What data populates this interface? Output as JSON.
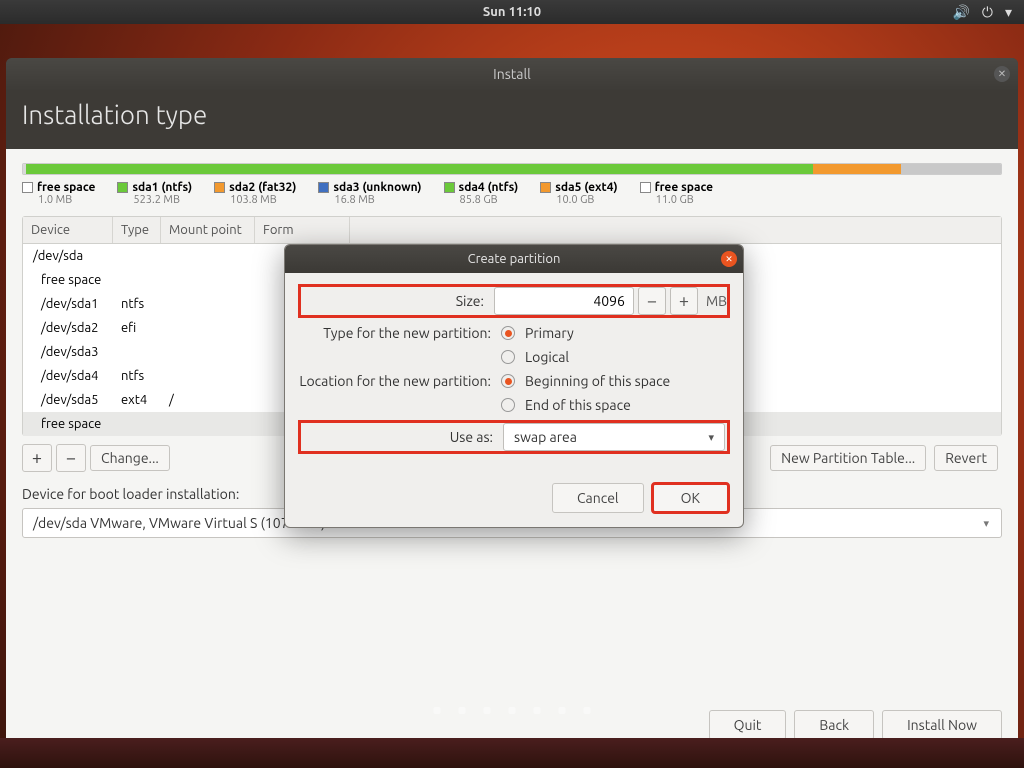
{
  "menubar": {
    "clock": "Sun 11:10"
  },
  "install": {
    "windowtitle": "Install",
    "heading": "Installation type",
    "legend": [
      {
        "name": "free space",
        "size": "1.0 MB",
        "swatch": "gray"
      },
      {
        "name": "sda1 (ntfs)",
        "size": "523.2 MB",
        "swatch": "green"
      },
      {
        "name": "sda2 (fat32)",
        "size": "103.8 MB",
        "swatch": "orange"
      },
      {
        "name": "sda3 (unknown)",
        "size": "16.8 MB",
        "swatch": "blue"
      },
      {
        "name": "sda4 (ntfs)",
        "size": "85.8 GB",
        "swatch": "green"
      },
      {
        "name": "sda5 (ext4)",
        "size": "10.0 GB",
        "swatch": "orange"
      },
      {
        "name": "free space",
        "size": "11.0 GB",
        "swatch": "gray"
      }
    ],
    "tablehead": {
      "device": "Device",
      "type": "Type",
      "mount": "Mount point",
      "format": "Form"
    },
    "rows": [
      {
        "device": "/dev/sda",
        "type": "",
        "mount": ""
      },
      {
        "device": "free space",
        "type": "",
        "mount": ""
      },
      {
        "device": "/dev/sda1",
        "type": "ntfs",
        "mount": ""
      },
      {
        "device": "/dev/sda2",
        "type": "efi",
        "mount": ""
      },
      {
        "device": "/dev/sda3",
        "type": "",
        "mount": ""
      },
      {
        "device": "/dev/sda4",
        "type": "ntfs",
        "mount": ""
      },
      {
        "device": "/dev/sda5",
        "type": "ext4",
        "mount": "/"
      },
      {
        "device": "free space",
        "type": "",
        "mount": ""
      }
    ],
    "buttons": {
      "plus": "+",
      "minus": "−",
      "change": "Change...",
      "newtable": "New Partition Table...",
      "revert": "Revert"
    },
    "bootlabel": "Device for boot loader installation:",
    "bootdevice": "/dev/sda   VMware, VMware Virtual S (107.4 GB)",
    "footer": {
      "quit": "Quit",
      "back": "Back",
      "install": "Install Now"
    }
  },
  "dialog": {
    "title": "Create partition",
    "size_label": "Size:",
    "size_value": "4096",
    "size_unit": "MB",
    "type_label": "Type for the new partition:",
    "type_primary": "Primary",
    "type_logical": "Logical",
    "loc_label": "Location for the new partition:",
    "loc_begin": "Beginning of this space",
    "loc_end": "End of this space",
    "useas_label": "Use as:",
    "useas_value": "swap area",
    "cancel": "Cancel",
    "ok": "OK"
  }
}
